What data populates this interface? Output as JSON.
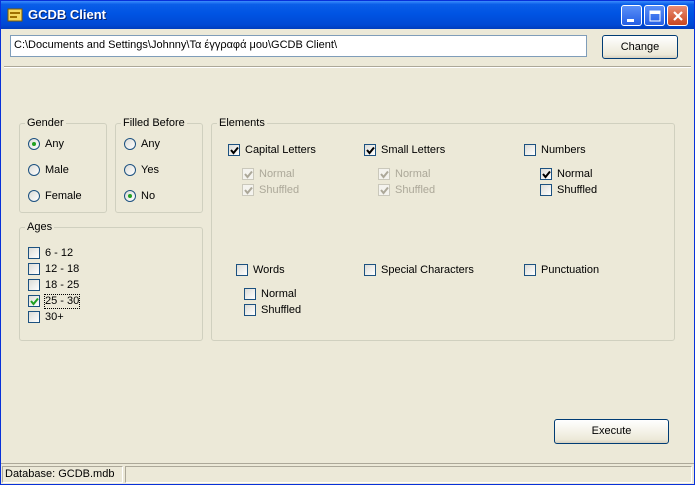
{
  "window": {
    "title": "GCDB Client"
  },
  "path": {
    "value": "C:\\Documents and Settings\\Johnny\\Τα έγγραφά μου\\GCDB Client\\"
  },
  "buttons": {
    "change": "Change",
    "execute": "Execute"
  },
  "gender": {
    "label": "Gender",
    "options": [
      {
        "label": "Any",
        "selected": true
      },
      {
        "label": "Male",
        "selected": false
      },
      {
        "label": "Female",
        "selected": false
      }
    ]
  },
  "filled_before": {
    "label": "Filled Before",
    "options": [
      {
        "label": "Any",
        "selected": false
      },
      {
        "label": "Yes",
        "selected": false
      },
      {
        "label": "No",
        "selected": true
      }
    ]
  },
  "ages": {
    "label": "Ages",
    "items": [
      {
        "label": "6 - 12",
        "checked": false
      },
      {
        "label": "12 - 18",
        "checked": false
      },
      {
        "label": "18 - 25",
        "checked": false
      },
      {
        "label": "25 - 30",
        "checked": true
      },
      {
        "label": "30+",
        "checked": false
      }
    ]
  },
  "elements": {
    "label": "Elements",
    "capital_letters": {
      "label": "Capital Letters",
      "checked": true,
      "normal": "Normal",
      "shuffled": "Shuffled",
      "normal_checked": true,
      "shuffled_checked": true,
      "sub_enabled": false
    },
    "small_letters": {
      "label": "Small Letters",
      "checked": true,
      "normal": "Normal",
      "shuffled": "Shuffled",
      "normal_checked": true,
      "shuffled_checked": true,
      "sub_enabled": false
    },
    "numbers": {
      "label": "Numbers",
      "checked": false,
      "normal": "Normal",
      "shuffled": "Shuffled",
      "normal_checked": true,
      "shuffled_checked": false,
      "sub_enabled": true
    },
    "words": {
      "label": "Words",
      "checked": false,
      "normal": "Normal",
      "shuffled": "Shuffled",
      "normal_checked": false,
      "shuffled_checked": false,
      "sub_enabled": true
    },
    "special_characters": {
      "label": "Special Characters",
      "checked": false
    },
    "punctuation": {
      "label": "Punctuation",
      "checked": false
    }
  },
  "status": {
    "database": "Database: GCDB.mdb"
  }
}
